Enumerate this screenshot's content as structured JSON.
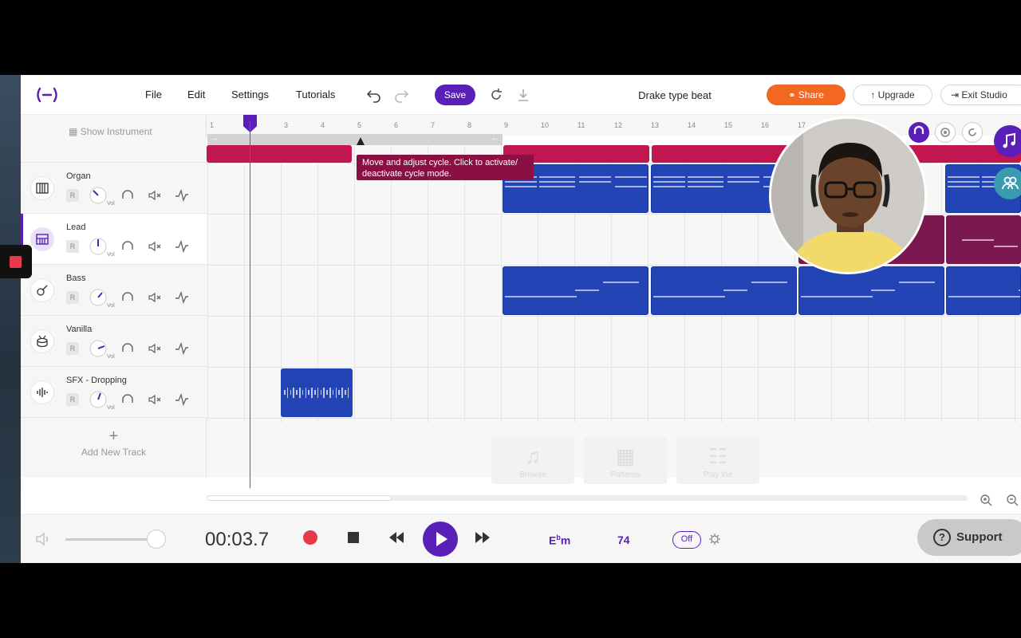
{
  "menu": {
    "file": "File",
    "edit": "Edit",
    "settings": "Settings",
    "tutorials": "Tutorials"
  },
  "toolbar": {
    "save": "Save",
    "project_title": "Drake type beat",
    "share": "Share",
    "upgrade": "Upgrade",
    "exit": "Exit Studio"
  },
  "sidebar": {
    "show_instrument": "Show Instrument",
    "add_track": "Add New Track",
    "vol_label": "Vol",
    "record_label": "R"
  },
  "tracks": [
    {
      "name": "Organ",
      "icon": "organ-icon",
      "volume": 0.3
    },
    {
      "name": "Lead",
      "icon": "synth-icon",
      "volume": 0.5,
      "selected": true
    },
    {
      "name": "Bass",
      "icon": "guitar-icon",
      "volume": 0.7
    },
    {
      "name": "Vanilla",
      "icon": "drum-icon",
      "volume": 0.8
    },
    {
      "name": "SFX - Dropping",
      "icon": "waveform-icon",
      "volume": 0.6
    }
  ],
  "ruler": {
    "bars": [
      "1",
      "3",
      "4",
      "5",
      "6",
      "7",
      "8",
      "9",
      "10",
      "11",
      "12",
      "13",
      "14",
      "15",
      "16",
      "17"
    ]
  },
  "tooltip": {
    "line1": "Move and adjust cycle. Click to activate/",
    "line2": "deactivate cycle mode."
  },
  "empty_panels": [
    {
      "label": "Browse"
    },
    {
      "label": "Patterns"
    },
    {
      "label": "Play the"
    }
  ],
  "transport": {
    "time": "00:03.7",
    "key_root": "E",
    "key_flat": "b",
    "key_mode": "m",
    "bpm": "74",
    "metronome": "Off",
    "master_volume": 0.95
  },
  "support": {
    "label": "Support"
  },
  "colors": {
    "accent": "#5a1fb8",
    "share": "#f26722",
    "clip_blue": "#2344b5",
    "clip_red": "#c21650"
  }
}
